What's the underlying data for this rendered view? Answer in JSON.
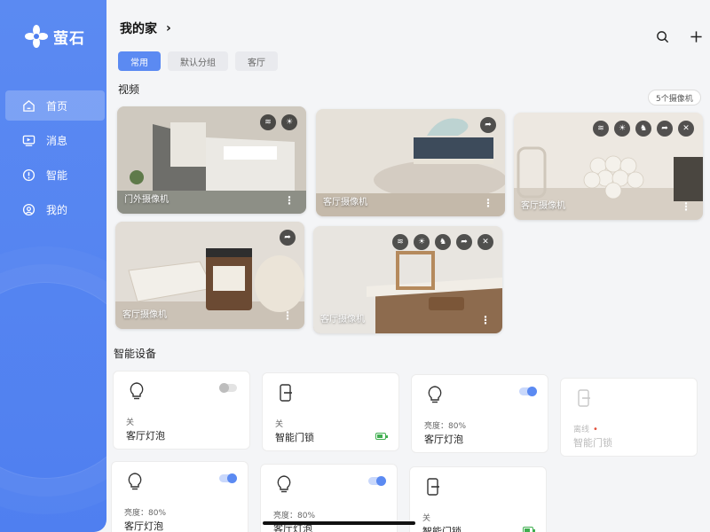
{
  "sidebar": {
    "logo_text": "萤石",
    "items": [
      {
        "label": "首页",
        "icon": "home-icon",
        "active": true
      },
      {
        "label": "消息",
        "icon": "message-icon",
        "active": false
      },
      {
        "label": "智能",
        "icon": "smart-icon",
        "active": false
      },
      {
        "label": "我的",
        "icon": "profile-icon",
        "active": false
      }
    ]
  },
  "header": {
    "title": "我的家",
    "chevron": "›",
    "search_icon": "search-icon",
    "add_icon": "plus-icon"
  },
  "tabs": [
    {
      "label": "常用",
      "active": true
    },
    {
      "label": "默认分组",
      "active": false
    },
    {
      "label": "客厅",
      "active": false
    }
  ],
  "video": {
    "title": "视频",
    "count_label": "5个摄像机",
    "cameras": [
      {
        "name": "门外摄像机",
        "actions": [
          "wifi-icon",
          "brightness-icon"
        ]
      },
      {
        "name": "客厅摄像机",
        "actions": [
          "share-icon"
        ]
      },
      {
        "name": "客厅摄像机",
        "actions": [
          "wifi-icon",
          "brightness-icon",
          "motion-icon",
          "share-icon",
          "close-icon"
        ]
      },
      {
        "name": "客厅摄像机",
        "actions": [
          "share-icon"
        ]
      },
      {
        "name": "客厅摄像机",
        "actions": [
          "wifi-icon",
          "brightness-icon",
          "motion-icon",
          "share-icon",
          "close-icon"
        ]
      }
    ],
    "more_glyph": "⋮"
  },
  "devices": {
    "title": "智能设备",
    "items": [
      {
        "type": "bulb",
        "state": "关",
        "name": "客厅灯泡",
        "toggle": "off"
      },
      {
        "type": "lock",
        "state": "关",
        "name": "智能门锁",
        "battery": true
      },
      {
        "type": "bulb",
        "state": "亮度：80%",
        "name": "客厅灯泡",
        "toggle": "on"
      },
      {
        "type": "lock",
        "state": "离线",
        "name": "智能门锁",
        "offline": true,
        "offline_dot": "•"
      },
      {
        "type": "bulb",
        "state": "亮度：80%",
        "name": "客厅灯泡",
        "toggle": "on"
      },
      {
        "type": "bulb",
        "state": "亮度：80%",
        "name": "客厅灯泡",
        "toggle": "on"
      },
      {
        "type": "lock",
        "state": "关",
        "name": "智能门锁",
        "battery": true
      }
    ]
  },
  "colors": {
    "accent": "#5b8af2",
    "battery": "#3fae4f",
    "offline_dot": "#e2513c"
  }
}
